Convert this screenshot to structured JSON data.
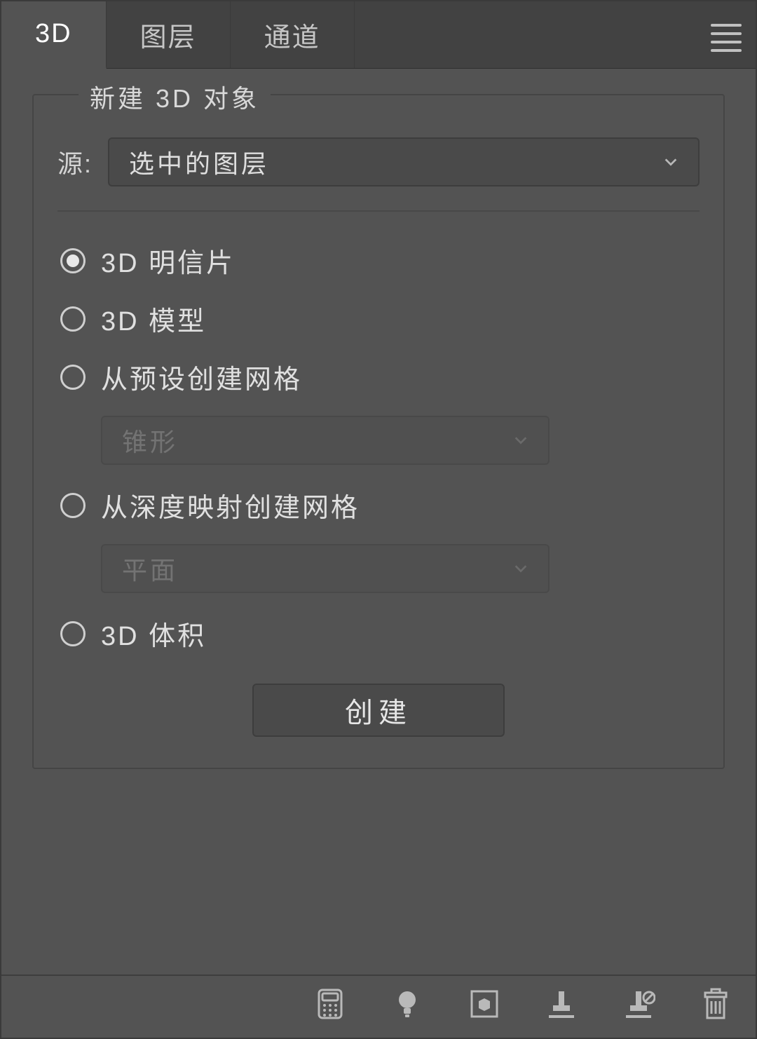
{
  "tabs": {
    "t3d": "3D",
    "layers": "图层",
    "channels": "通道"
  },
  "panel": {
    "title": "新建 3D 对象",
    "source_label": "源:",
    "source_value": "选中的图层",
    "create_btn": "创建"
  },
  "radios": {
    "postcard": "3D 明信片",
    "model": "3D 模型",
    "preset_mesh": "从预设创建网格",
    "preset_shape": "锥形",
    "depth_mesh": "从深度映射创建网格",
    "depth_shape": "平面",
    "volume": "3D 体积"
  }
}
